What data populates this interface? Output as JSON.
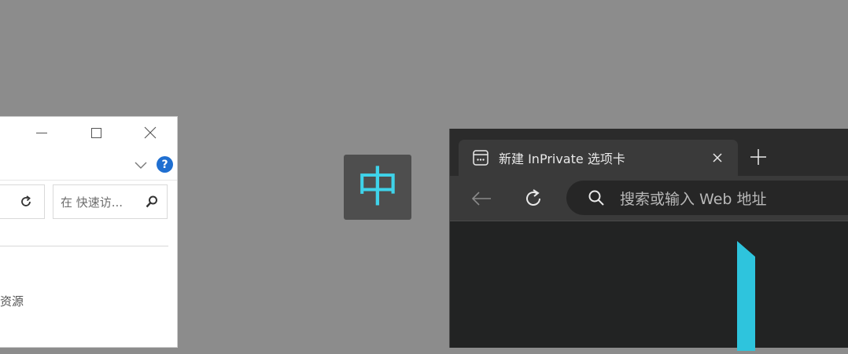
{
  "explorer": {
    "search_placeholder": "在 快速访...",
    "nav_item": "资源",
    "colors": {
      "help": "#1f6fd1"
    }
  },
  "ime": {
    "mode": "中",
    "color": "#3fd3ea"
  },
  "edge": {
    "tab": {
      "title": "新建 InPrivate 选项卡"
    },
    "address": {
      "placeholder": "搜索或输入 Web 地址"
    }
  },
  "icons": [
    "minimize-icon",
    "maximize-icon",
    "close-icon",
    "chevron-down-icon",
    "help-icon",
    "refresh-icon",
    "search-icon",
    "inprivate-tab-icon",
    "plus-icon",
    "back-arrow-icon",
    "reload-icon",
    "mouse-pointer-icon"
  ]
}
